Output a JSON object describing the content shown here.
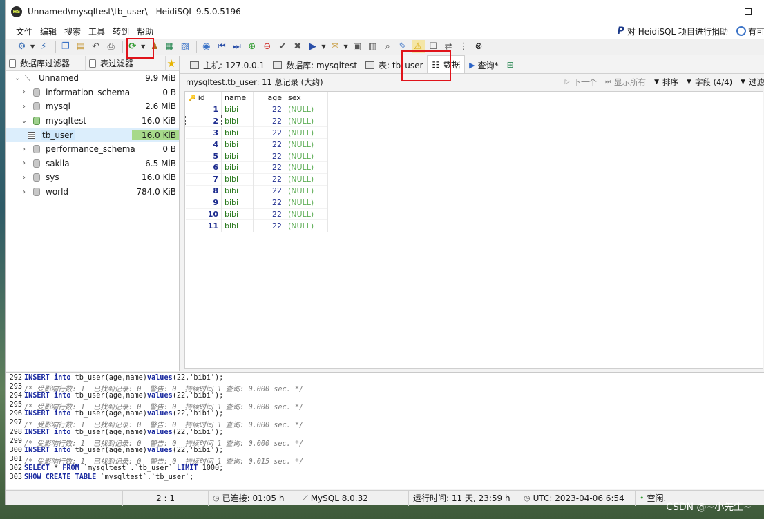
{
  "window": {
    "title": "Unnamed\\mysqltest\\tb_user\\ - HeidiSQL 9.5.0.5196",
    "logo": "HS"
  },
  "menu": [
    "文件",
    "编辑",
    "搜索",
    "工具",
    "转到",
    "帮助"
  ],
  "donate": {
    "label": "对 HeidiSQL 项目进行捐助",
    "update_label": "有可"
  },
  "left": {
    "filter_db": "数据库过滤器",
    "filter_table": "表过滤器",
    "tree": [
      {
        "name": "Unnamed",
        "size": "9.9 MiB"
      },
      {
        "name": "information_schema",
        "size": "0 B"
      },
      {
        "name": "mysql",
        "size": "2.6 MiB"
      },
      {
        "name": "mysqltest",
        "size": "16.0 KiB"
      },
      {
        "name": "tb_user",
        "size": "16.0 KiB"
      },
      {
        "name": "performance_schema",
        "size": "0 B"
      },
      {
        "name": "sakila",
        "size": "6.5 MiB"
      },
      {
        "name": "sys",
        "size": "16.0 KiB"
      },
      {
        "name": "world",
        "size": "784.0 KiB"
      }
    ]
  },
  "tabs": {
    "host": "主机: 127.0.0.1",
    "database": "数据库: mysqltest",
    "table": "表: tb_user",
    "data": "数据",
    "query": "查询*"
  },
  "grid": {
    "summary": "mysqltest.tb_user: 11 总记录 (大约)",
    "next": "下一个",
    "show_all": "显示所有",
    "sort": "排序",
    "columns": "字段 (4/4)",
    "filter": "过滤",
    "headers": [
      "id",
      "name",
      "age",
      "sex"
    ],
    "rows": [
      [
        "1",
        "bibi",
        "22",
        "(NULL)"
      ],
      [
        "2",
        "bibi",
        "22",
        "(NULL)"
      ],
      [
        "3",
        "bibi",
        "22",
        "(NULL)"
      ],
      [
        "4",
        "bibi",
        "22",
        "(NULL)"
      ],
      [
        "5",
        "bibi",
        "22",
        "(NULL)"
      ],
      [
        "6",
        "bibi",
        "22",
        "(NULL)"
      ],
      [
        "7",
        "bibi",
        "22",
        "(NULL)"
      ],
      [
        "8",
        "bibi",
        "22",
        "(NULL)"
      ],
      [
        "9",
        "bibi",
        "22",
        "(NULL)"
      ],
      [
        "10",
        "bibi",
        "22",
        "(NULL)"
      ],
      [
        "11",
        "bibi",
        "22",
        "(NULL)"
      ]
    ]
  },
  "log": [
    {
      "n": "292",
      "type": "sql",
      "text": "INSERT into tb_user(age,name)values(22,'bibi');"
    },
    {
      "n": "293",
      "type": "comment",
      "text": "/* 受影响行数: 1  已找到记录: 0  警告: 0  持续时间 1 查询: 0.000 sec. */"
    },
    {
      "n": "294",
      "type": "sql",
      "text": "INSERT into tb_user(age,name)values(22,'bibi');"
    },
    {
      "n": "295",
      "type": "comment",
      "text": "/* 受影响行数: 1  已找到记录: 0  警告: 0  持续时间 1 查询: 0.000 sec. */"
    },
    {
      "n": "296",
      "type": "sql",
      "text": "INSERT into tb_user(age,name)values(22,'bibi');"
    },
    {
      "n": "297",
      "type": "comment",
      "text": "/* 受影响行数: 1  已找到记录: 0  警告: 0  持续时间 1 查询: 0.000 sec. */"
    },
    {
      "n": "298",
      "type": "sql",
      "text": "INSERT into tb_user(age,name)values(22,'bibi');"
    },
    {
      "n": "299",
      "type": "comment",
      "text": "/* 受影响行数: 1  已找到记录: 0  警告: 0  持续时间 1 查询: 0.000 sec. */"
    },
    {
      "n": "300",
      "type": "sql",
      "text": "INSERT into tb_user(age,name)values(22,'bibi');"
    },
    {
      "n": "301",
      "type": "comment",
      "text": "/* 受影响行数: 1  已找到记录: 0  警告: 0  持续时间 1 查询: 0.015 sec. */"
    },
    {
      "n": "302",
      "type": "sql",
      "text": "SELECT * FROM `mysqltest`.`tb_user` LIMIT 1000;"
    },
    {
      "n": "303",
      "type": "sql",
      "text": "SHOW CREATE TABLE `mysqltest`.`tb_user`;"
    }
  ],
  "status": {
    "cursor": "2 : 1",
    "connected": "已连接: 01:05 h",
    "server": "MySQL 8.0.32",
    "uptime": "运行时间: 11 天, 23:59 h",
    "utc": "UTC: 2023-04-06 6:54",
    "idle": "空闲."
  },
  "watermark": "CSDN @~小先生~",
  "colors": {
    "highlight": "#e0131a",
    "selected_size": "#a7d98a"
  }
}
